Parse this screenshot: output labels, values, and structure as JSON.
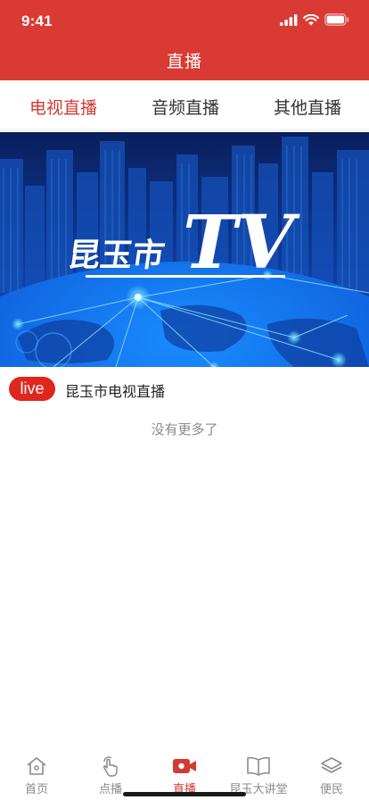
{
  "status_bar": {
    "time": "9:41"
  },
  "header": {
    "title": "直播"
  },
  "tabs": [
    {
      "label": "电视直播",
      "active": true
    },
    {
      "label": "音频直播",
      "active": false
    },
    {
      "label": "其他直播",
      "active": false
    }
  ],
  "banner": {
    "logo_text": "昆玉市",
    "tv_text": "TV"
  },
  "channels": [
    {
      "badge": "live",
      "title": "昆玉市电视直播"
    }
  ],
  "list_end_text": "没有更多了",
  "tabbar": [
    {
      "label": "首页",
      "icon": "home-icon",
      "active": false
    },
    {
      "label": "点播",
      "icon": "tap-hand-icon",
      "active": false
    },
    {
      "label": "直播",
      "icon": "video-camera-icon",
      "active": true
    },
    {
      "label": "昆玉大讲堂",
      "icon": "open-book-icon",
      "active": false
    },
    {
      "label": "便民",
      "icon": "layers-icon",
      "active": false
    }
  ],
  "colors": {
    "brand": "#d93a34",
    "active_text": "#d23a33",
    "inactive_text": "#8a8a8a"
  }
}
